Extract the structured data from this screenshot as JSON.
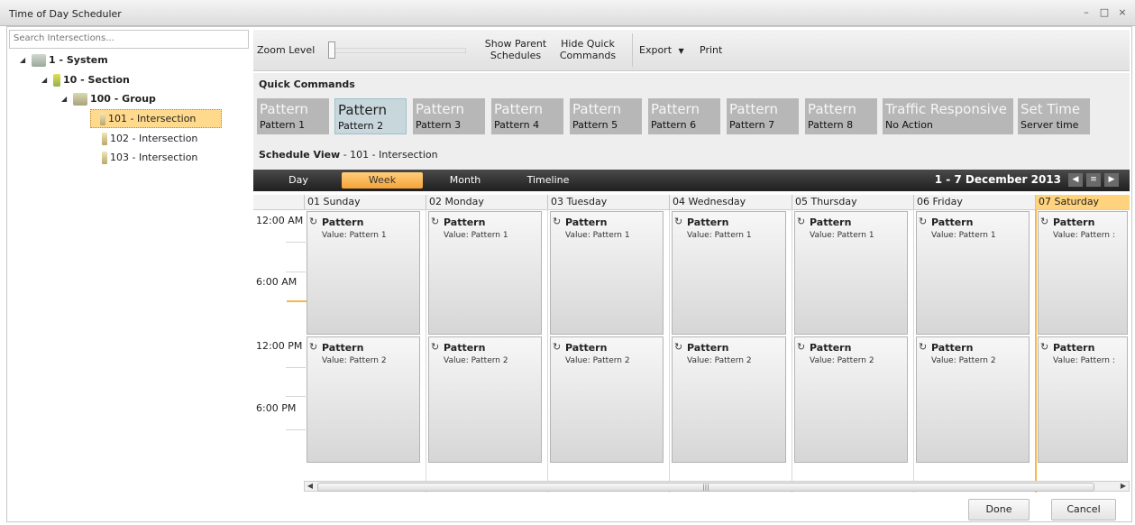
{
  "window": {
    "title": "Time of Day Scheduler",
    "min_icon": "minimize-icon",
    "max_icon": "maximize-icon",
    "close_icon": "close-icon"
  },
  "sidebar": {
    "search_placeholder": "Search Intersections...",
    "tree": [
      {
        "label": "1 - System"
      },
      {
        "label": "10 - Section"
      },
      {
        "label": "100 - Group"
      },
      {
        "label": "101 - Intersection"
      },
      {
        "label": "102 - Intersection"
      },
      {
        "label": "103 - Intersection"
      }
    ]
  },
  "toolbar": {
    "zoom_label": "Zoom Level",
    "show_parent": [
      "Show Parent",
      "Schedules"
    ],
    "hide_quick": [
      "Hide Quick",
      "Commands"
    ],
    "export": "Export",
    "print": "Print"
  },
  "quick_commands": {
    "title": "Quick Commands",
    "buttons": [
      {
        "l1": "Pattern",
        "l2": "Pattern 1"
      },
      {
        "l1": "Pattern",
        "l2": "Pattern 2"
      },
      {
        "l1": "Pattern",
        "l2": "Pattern 3"
      },
      {
        "l1": "Pattern",
        "l2": "Pattern 4"
      },
      {
        "l1": "Pattern",
        "l2": "Pattern 5"
      },
      {
        "l1": "Pattern",
        "l2": "Pattern 6"
      },
      {
        "l1": "Pattern",
        "l2": "Pattern 7"
      },
      {
        "l1": "Pattern",
        "l2": "Pattern 8"
      },
      {
        "l1": "Traffic Responsive",
        "l2": "No Action"
      },
      {
        "l1": "Set Time",
        "l2": "Server time"
      }
    ]
  },
  "schedule": {
    "title_bold": "Schedule View",
    "title_rest": " - 101 - Intersection",
    "tabs": [
      "Day",
      "Week",
      "Month",
      "Timeline"
    ],
    "date_range": "1 - 7 December 2013",
    "days": [
      "01 Sunday",
      "02 Monday",
      "03 Tuesday",
      "04 Wednesday",
      "05 Thursday",
      "06 Friday",
      "07 Saturday"
    ],
    "times": [
      "12:00 AM",
      "6:00 AM",
      "12:00 PM",
      "6:00 PM"
    ],
    "event_title": "Pattern",
    "am_value": "Value: Pattern 1",
    "pm_value": "Value: Pattern 2",
    "am_value_truncated": "Value: Pattern :",
    "pm_value_truncated": "Value: Pattern :"
  },
  "footer": {
    "done": "Done",
    "cancel": "Cancel"
  }
}
